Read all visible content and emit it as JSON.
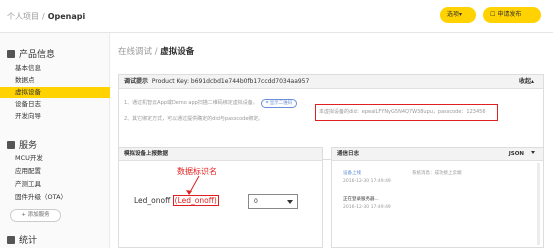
{
  "header": {
    "breadcrumb_root": "个人项目",
    "breadcrumb_sep": "/",
    "project_name": "Openapi",
    "options_label": "选项▾",
    "publish_label": "申请发布"
  },
  "sidebar": {
    "section_product": "产品信息",
    "product_items": [
      "基本信息",
      "数据点",
      "虚拟设备",
      "设备日志",
      "开发向导"
    ],
    "active_index": 2,
    "section_service": "服务",
    "service_items": [
      "MCU开发",
      "应用配置",
      "产测工具",
      "固件升级（OTA）"
    ],
    "add_service": "+ 添加服务",
    "section_stats": "统计"
  },
  "main": {
    "title_prefix": "在线调试 / ",
    "title_current": "虚拟设备",
    "tip_label": "调试提示",
    "product_key_text": "Product Key: b691dcbd1e744b0fb17ccdd7034aa957",
    "collapse_label": "收起▴",
    "tip_line1": "1、通过机智云App或Demo app扫描二维码绑定虚拟设备。",
    "qr_button": "显示二维码",
    "tip_line2": "2、其它绑定方式，可以通过提供确定的did与passcode绑定。",
    "did_text": "本虚拟设备的did：epeaILFYNyG5N4Q7W38upu，passcode：123456",
    "report_panel_title": "模拟设备上报数据",
    "annotation": "数据标识名",
    "led_label": "Led_onoff",
    "led_id_prefix": "(",
    "led_id": "Led_onoff",
    "led_id_suffix": ")",
    "led_value": "0",
    "log_panel_title": "通信日志",
    "json_label": "JSON",
    "logs": [
      {
        "title": "设备上线",
        "time": "2016-12-30 17:49:49",
        "right": "系统消息：成功接上云端"
      },
      {
        "title": "正在登录服务器...",
        "time": "2016-12-30 17:49:49",
        "right": ""
      }
    ]
  },
  "colors": {
    "accent": "#ffd200",
    "annotation_red": "#e02020",
    "link_blue": "#5b8bd5"
  }
}
